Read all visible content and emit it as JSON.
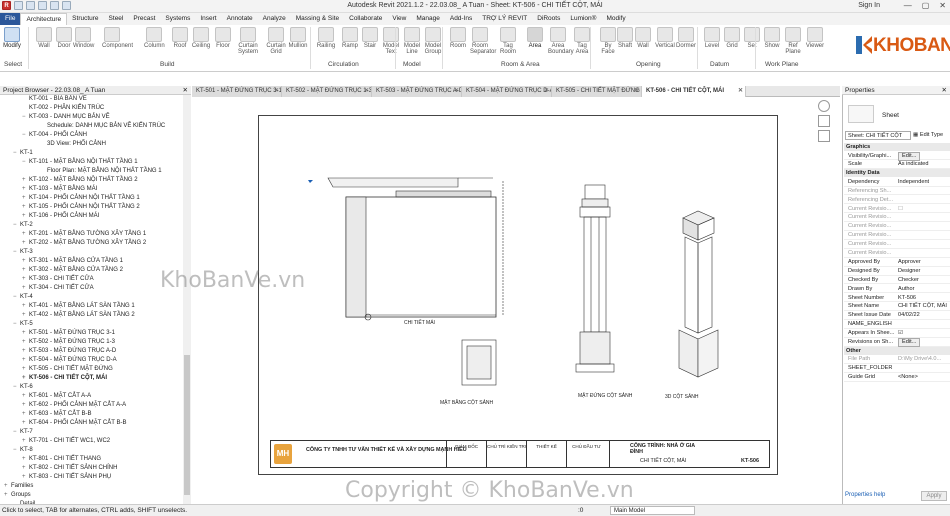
{
  "titlebar": {
    "title": "Autodesk Revit 2021.1.2 - 22.03.08_ A Tuan - Sheet: KT-506 - CHI TIẾT CỘT, MÁI",
    "signin": "Sign In"
  },
  "ribbon_tabs": [
    "File",
    "Architecture",
    "Structure",
    "Steel",
    "Precast",
    "Systems",
    "Insert",
    "Annotate",
    "Analyze",
    "Massing & Site",
    "Collaborate",
    "View",
    "Manage",
    "Add-Ins",
    "TRỢ LÝ REVIT",
    "DiRoots",
    "Lumion®",
    "Modify"
  ],
  "ribbon": {
    "buttons": [
      "Modify",
      "Wall",
      "Door",
      "Window",
      "Component",
      "Column",
      "Roof",
      "Ceiling",
      "Floor",
      "Curtain System",
      "Curtain Grid",
      "Mullion",
      "Railing",
      "Ramp",
      "Stair",
      "Model Text",
      "Model Line",
      "Model Group",
      "Room",
      "Room Separator",
      "Tag Room",
      "Area",
      "Area Boundary",
      "Tag Area",
      "By Face",
      "Shaft",
      "Wall",
      "Vertical",
      "Dormer",
      "Level",
      "Grid",
      "Set",
      "Show",
      "Ref Plane",
      "Viewer"
    ],
    "groups": [
      "Select",
      "Build",
      "Circulation",
      "Model",
      "Room & Area",
      "Opening",
      "Datum",
      "Work Plane"
    ]
  },
  "logo_text": "KHOBANVE",
  "project_browser": {
    "title": "Project Browser - 22.03.08_ A Tuan",
    "rows": [
      {
        "t": "KT-001 - BÌA BẢN VẼ",
        "i": 2
      },
      {
        "t": "KT-002 - PHÂN KIẾN TRÚC",
        "i": 2
      },
      {
        "t": "KT-003 - DANH MỤC BẢN VẼ",
        "i": 2,
        "tg": "−"
      },
      {
        "t": "Schedule: DANH MỤC BẢN VẼ KIẾN TRÚC",
        "i": 4
      },
      {
        "t": "KT-004 - PHỐI CẢNH",
        "i": 2,
        "tg": "−"
      },
      {
        "t": "3D View: PHỐI CẢNH",
        "i": 4
      },
      {
        "t": "KT-1",
        "i": 1,
        "tg": "−"
      },
      {
        "t": "KT-101 - MẶT BẰNG NỘI THẤT TẦNG 1",
        "i": 2,
        "tg": "−"
      },
      {
        "t": "Floor Plan: MẶT BẰNG NỘI THẤT TẦNG 1",
        "i": 4
      },
      {
        "t": "KT-102 - MẶT BẰNG NỘI THẤT TẦNG 2",
        "i": 2,
        "tg": "+"
      },
      {
        "t": "KT-103 - MẶT BẰNG MÁI",
        "i": 2,
        "tg": "+"
      },
      {
        "t": "KT-104 - PHỐI CẢNH NỘI THẤT TẦNG 1",
        "i": 2,
        "tg": "+"
      },
      {
        "t": "KT-105 - PHỐI CẢNH NỘI THẤT TẦNG 2",
        "i": 2,
        "tg": "+"
      },
      {
        "t": "KT-106 - PHỐI CẢNH MÁI",
        "i": 2,
        "tg": "+"
      },
      {
        "t": "KT-2",
        "i": 1,
        "tg": "−"
      },
      {
        "t": "KT-201 - MẶT BẰNG TƯỜNG XÂY TẦNG 1",
        "i": 2,
        "tg": "+"
      },
      {
        "t": "KT-202 - MẶT BẰNG TƯỜNG XÂY TẦNG 2",
        "i": 2,
        "tg": "+"
      },
      {
        "t": "KT-3",
        "i": 1,
        "tg": "−"
      },
      {
        "t": "KT-301 - MẶT BẰNG CỬA TẦNG 1",
        "i": 2,
        "tg": "+"
      },
      {
        "t": "KT-302 - MẶT BẰNG CỬA TẦNG 2",
        "i": 2,
        "tg": "+"
      },
      {
        "t": "KT-303 - CHI TIẾT CỬA",
        "i": 2,
        "tg": "+"
      },
      {
        "t": "KT-304 - CHI TIẾT CỬA",
        "i": 2,
        "tg": "+"
      },
      {
        "t": "KT-4",
        "i": 1,
        "tg": "−"
      },
      {
        "t": "KT-401 - MẶT BẰNG LÁT SÀN TẦNG 1",
        "i": 2,
        "tg": "+"
      },
      {
        "t": "KT-402 - MẶT BẰNG LÁT SÀN TẦNG 2",
        "i": 2,
        "tg": "+"
      },
      {
        "t": "KT-5",
        "i": 1,
        "tg": "−"
      },
      {
        "t": "KT-501 - MẶT ĐỨNG TRỤC 3-1",
        "i": 2,
        "tg": "+"
      },
      {
        "t": "KT-502 - MẶT ĐỨNG TRỤC 1-3",
        "i": 2,
        "tg": "+"
      },
      {
        "t": "KT-503 - MẶT ĐỨNG TRỤC A-D",
        "i": 2,
        "tg": "+"
      },
      {
        "t": "KT-504 - MẶT ĐỨNG  TRỤC D-A",
        "i": 2,
        "tg": "+"
      },
      {
        "t": "KT-505 - CHI TIẾT MẶT ĐỨNG",
        "i": 2,
        "tg": "+"
      },
      {
        "t": "KT-506 - CHI TIẾT CỘT, MÁI",
        "i": 2,
        "tg": "+",
        "sel": true
      },
      {
        "t": "KT-6",
        "i": 1,
        "tg": "−"
      },
      {
        "t": "KT-601 - MẶT CẮT A-A",
        "i": 2,
        "tg": "+"
      },
      {
        "t": "KT-602 - PHỐI CẢNH MẶT CẮT A-A",
        "i": 2,
        "tg": "+"
      },
      {
        "t": "KT-603 - MẶT CẮT B-B",
        "i": 2,
        "tg": "+"
      },
      {
        "t": "KT-604 - PHỐI CẢNH MẶT CẮT B-B",
        "i": 2,
        "tg": "+"
      },
      {
        "t": "KT-7",
        "i": 1,
        "tg": "−"
      },
      {
        "t": "KT-701 - CHI TIẾT WC1, WC2",
        "i": 2,
        "tg": "+"
      },
      {
        "t": "KT-8",
        "i": 1,
        "tg": "−"
      },
      {
        "t": "KT-801 - CHI TIẾT THANG",
        "i": 2,
        "tg": "+"
      },
      {
        "t": "KT-802 - CHI TIẾT SẢNH CHÍNH",
        "i": 2,
        "tg": "+"
      },
      {
        "t": "KT-803 - CHI TIẾT SẢNH PHỤ",
        "i": 2,
        "tg": "+"
      },
      {
        "t": "Families",
        "i": 0,
        "tg": "+"
      },
      {
        "t": "Groups",
        "i": 0,
        "tg": "+"
      },
      {
        "t": "Detail",
        "i": 1
      }
    ]
  },
  "view_tabs": [
    "KT-501 - MẶT ĐỨNG TRỤC 3-1",
    "KT-502 - MẶT ĐỨNG TRỤC 1-3",
    "KT-503 - MẶT ĐỨNG TRỤC A-D",
    "KT-504 - MẶT ĐỨNG TRỤC D-A",
    "KT-505 - CHI TIẾT MẶT ĐỨNG",
    "KT-506 - CHI TIẾT CỘT, MÁI"
  ],
  "drawing": {
    "labels": {
      "roof": "CHI TIẾT MÁI",
      "plan": "MẶT BẰNG CỘT SẢNH",
      "elev": "MẶT ĐỨNG CỘT SẢNH",
      "iso": "3D CỘT SẢNH",
      "dim1": "1300"
    },
    "titleblock": {
      "company": "CÔNG TY TNHH TƯ VẤN THIẾT KẾ VÀ XÂY DỰNG MẠNH HIẾU",
      "roles": [
        "GIÁM ĐỐC",
        "CHỦ TRÌ KIẾN TRÚC",
        "THIẾT KẾ",
        "CHỦ ĐẦU TƯ"
      ],
      "project": "CÔNG TRÌNH: NHÀ Ở GIA ĐÌNH",
      "sheet_title": "CHI TIẾT CỘT, MÁI",
      "sheet_no": "KT-506"
    }
  },
  "properties": {
    "title": "Properties",
    "type_name": "Sheet",
    "selector": "Sheet: CHI TIẾT CỘT",
    "edit_type": "Edit Type",
    "sections": [
      {
        "name": "Graphics",
        "rows": [
          [
            "Visibility/Graphi...",
            "Edit..."
          ],
          [
            "Scale",
            "As indicated"
          ]
        ]
      },
      {
        "name": "Identity Data",
        "rows": [
          [
            "Dependency",
            "Independent"
          ],
          [
            "Referencing Sh...",
            ""
          ],
          [
            "Referencing Det...",
            ""
          ],
          [
            "Current Revisio...",
            "☐"
          ],
          [
            "Current Revisio...",
            ""
          ],
          [
            "Current Revisio...",
            ""
          ],
          [
            "Current Revisio...",
            ""
          ],
          [
            "Current Revisio...",
            ""
          ],
          [
            "Current Revisio...",
            ""
          ],
          [
            "Approved By",
            "Approver"
          ],
          [
            "Designed By",
            "Designer"
          ],
          [
            "Checked By",
            "Checker"
          ],
          [
            "Drawn By",
            "Author"
          ],
          [
            "Sheet Number",
            "KT-506"
          ],
          [
            "Sheet Name",
            "CHI TIẾT CỘT, MÁI"
          ],
          [
            "Sheet Issue Date",
            "04/02/22"
          ],
          [
            "NAME_ENGLISH",
            ""
          ],
          [
            "Appears In Shee...",
            "☑"
          ],
          [
            "Revisions on Sh...",
            "Edit..."
          ]
        ]
      },
      {
        "name": "Other",
        "rows": [
          [
            "File Path",
            "D:\\My Drive\\4.0..."
          ],
          [
            "SHEET_FOLDER",
            ""
          ],
          [
            "Guide Grid",
            "<None>"
          ]
        ]
      }
    ],
    "help_link": "Properties help",
    "apply": "Apply"
  },
  "status": {
    "message": "Click to select, TAB for alternates, CTRL adds, SHIFT unselects.",
    "zero": ":0",
    "model": "Main Model"
  },
  "watermark": "KhoBanVe.vn",
  "copyright": "Copyright © KhoBanVe.vn"
}
